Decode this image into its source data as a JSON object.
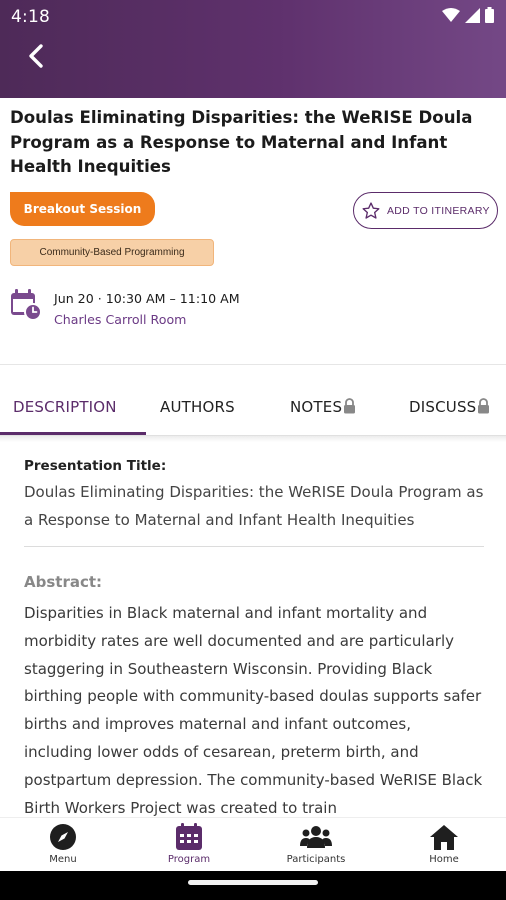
{
  "status_bar": {
    "time": "4:18"
  },
  "event": {
    "title": "Doulas Eliminating Disparities: the WeRISE Doula Program as a Response to Maternal and Infant Health Inequities",
    "session_type": "Breakout Session",
    "add_itinerary_label": "ADD TO ITINERARY",
    "track": "Community-Based Programming",
    "time": "Jun 20 · 10:30 AM – 11:10 AM",
    "room": "Charles Carroll Room"
  },
  "tabs": [
    {
      "label": "DESCRIPTION",
      "locked": false,
      "active": true
    },
    {
      "label": "AUTHORS",
      "locked": false,
      "active": false
    },
    {
      "label": "NOTES",
      "locked": true,
      "active": false
    },
    {
      "label": "DISCUSS",
      "locked": true,
      "active": false
    }
  ],
  "description": {
    "presentation_title_label": "Presentation Title:",
    "presentation_title": "Doulas Eliminating Disparities: the WeRISE Doula Program as a Response to Maternal and Infant Health Inequities",
    "abstract_label": "Abstract:",
    "abstract": "Disparities in Black maternal and infant mortality and morbidity rates are well documented and are particularly staggering in Southeastern Wisconsin. Providing Black birthing people with community-based doulas supports safer births and improves maternal and infant outcomes, including lower odds of cesarean, preterm birth, and postpartum depression. The community-based WeRISE Black Birth Workers Project was created to train"
  },
  "bottom_nav": [
    {
      "label": "Menu",
      "icon": "compass-icon",
      "active": false
    },
    {
      "label": "Program",
      "icon": "calendar-icon",
      "active": true
    },
    {
      "label": "Participants",
      "icon": "people-icon",
      "active": false
    },
    {
      "label": "Home",
      "icon": "home-icon",
      "active": false
    }
  ],
  "colors": {
    "primary": "#5b2c6a",
    "accent_orange": "#ee7b1c",
    "track_tag_bg": "#f7d0a7"
  }
}
